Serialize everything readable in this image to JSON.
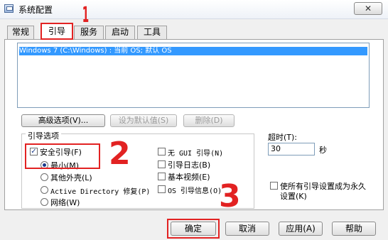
{
  "window": {
    "title": "系统配置",
    "close_glyph": "✕"
  },
  "tabs": [
    "常规",
    "引导",
    "服务",
    "启动",
    "工具"
  ],
  "boot_list": {
    "entries": [
      "Windows 7 (C:\\Windows) : 当前 OS; 默认 OS"
    ]
  },
  "buttons": {
    "advanced": "高级选项(V)...",
    "set_default": "设为默认值(S)",
    "delete": "删除(D)",
    "ok": "确定",
    "cancel": "取消",
    "apply": "应用(A)",
    "help": "帮助"
  },
  "boot_options": {
    "title": "引导选项",
    "safe_boot": {
      "label": "安全引导(F)",
      "checked": true
    },
    "minimal": {
      "label": "最小(M)",
      "selected": true
    },
    "alternate_shell": {
      "label": "其他外壳(L)",
      "selected": false
    },
    "active_directory": {
      "label": "Active Directory 修复(P)",
      "selected": false
    },
    "network": {
      "label": "网络(W)",
      "selected": false
    },
    "no_gui": {
      "label": "无 GUI 引导(N)",
      "checked": false
    },
    "boot_log": {
      "label": "引导日志(B)",
      "checked": false
    },
    "base_video": {
      "label": "基本视频(E)",
      "checked": false
    },
    "os_info": {
      "label": "OS 引导信息(O)",
      "checked": false
    }
  },
  "timeout": {
    "label": "超时(T):",
    "value": "30",
    "unit": "秒"
  },
  "permanent": {
    "label_line1": "使所有引导设置成为永久",
    "label_line2": "设置(K)",
    "checked": false
  },
  "annotations": {
    "mark_1": "1",
    "mark_2": "2",
    "mark_3": "3",
    "color": "#e22222"
  }
}
